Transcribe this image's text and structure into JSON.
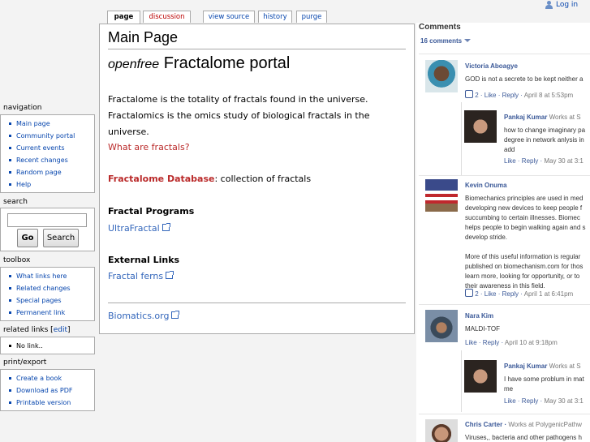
{
  "header": {
    "login_label": "Log in"
  },
  "tabs": [
    {
      "label": "page",
      "selected": true
    },
    {
      "label": "discussion"
    },
    {
      "label": "view source"
    },
    {
      "label": "history"
    },
    {
      "label": "purge"
    }
  ],
  "content": {
    "page_title": "Main Page",
    "portal_prefix": "openfree",
    "portal_title": "Fractalome portal",
    "intro": "Fractalome is the totality of fractals found in the universe. Fractalomics is the omics study of biological fractals in the universe.",
    "what_are_fractals": "What are fractals?",
    "database_link": "Fractalome Database",
    "database_desc": ": collection of fractals",
    "fractal_programs_heading": "Fractal Programs",
    "ultrafractal_link": "UltraFractal",
    "external_links_heading": "External Links",
    "fractal_ferns_link": "Fractal ferns",
    "biomatics_link": "Biomatics.org"
  },
  "sidebar": {
    "navigation": {
      "heading": "navigation",
      "items": [
        "Main page",
        "Community portal",
        "Current events",
        "Recent changes",
        "Random page",
        "Help"
      ]
    },
    "search": {
      "heading": "search",
      "go_label": "Go",
      "search_label": "Search"
    },
    "toolbox": {
      "heading": "toolbox",
      "items": [
        "What links here",
        "Related changes",
        "Special pages",
        "Permanent link"
      ]
    },
    "related_links": {
      "heading": "related links",
      "edit_label": "edit",
      "items": [
        "No link.."
      ]
    },
    "print_export": {
      "heading": "print/export",
      "items": [
        "Create a book",
        "Download as PDF",
        "Printable version"
      ]
    }
  },
  "comments": {
    "heading": "Comments",
    "count_label": "16 comments",
    "items": [
      {
        "name": "Victoria Aboagye",
        "works": "",
        "text": "GOD is not a secrete to be kept neither a",
        "likes": "2",
        "like_label": "Like",
        "reply_label": "Reply",
        "date": "April 8 at 5:53pm"
      },
      {
        "name": "Pankaj Kumar",
        "works": "Works at S",
        "text": "how to change imaginary pa\ndegree in network anlysis in\nadd",
        "likes": "",
        "like_label": "Like",
        "reply_label": "Reply",
        "date": "May 30 at 3:1"
      },
      {
        "name": "Kevin Onuma",
        "works": "",
        "text": "Biomechanics principles are used in med\ndeveloping new devices to keep people f\nsuccumbing to certain illnesses. Biomec\nhelps people to begin walking again and s\ndevelop stride.\n\nMore of this useful information is regular\npublished on biomechanism.com for thos\nlearn more, looking for opportunity, or to\ntheir awareness in this field.",
        "likes": "2",
        "like_label": "Like",
        "reply_label": "Reply",
        "date": "April 1 at 6:41pm"
      },
      {
        "name": "Nara Kim",
        "works": "",
        "text": "MALDI-TOF",
        "likes": "",
        "like_label": "Like",
        "reply_label": "Reply",
        "date": "April 10 at 9:18pm"
      },
      {
        "name": "Pankaj Kumar",
        "works": "Works at S",
        "text": "I have some problum in mat\nme",
        "likes": "",
        "like_label": "Like",
        "reply_label": "Reply",
        "date": "May 30 at 3:1"
      },
      {
        "name": "Chris Carter",
        "works": "Works at PolygenicPathw",
        "text": "Viruses,, bacteria and other pathogens h",
        "likes": "",
        "like_label": "",
        "reply_label": "",
        "date": ""
      }
    ]
  }
}
